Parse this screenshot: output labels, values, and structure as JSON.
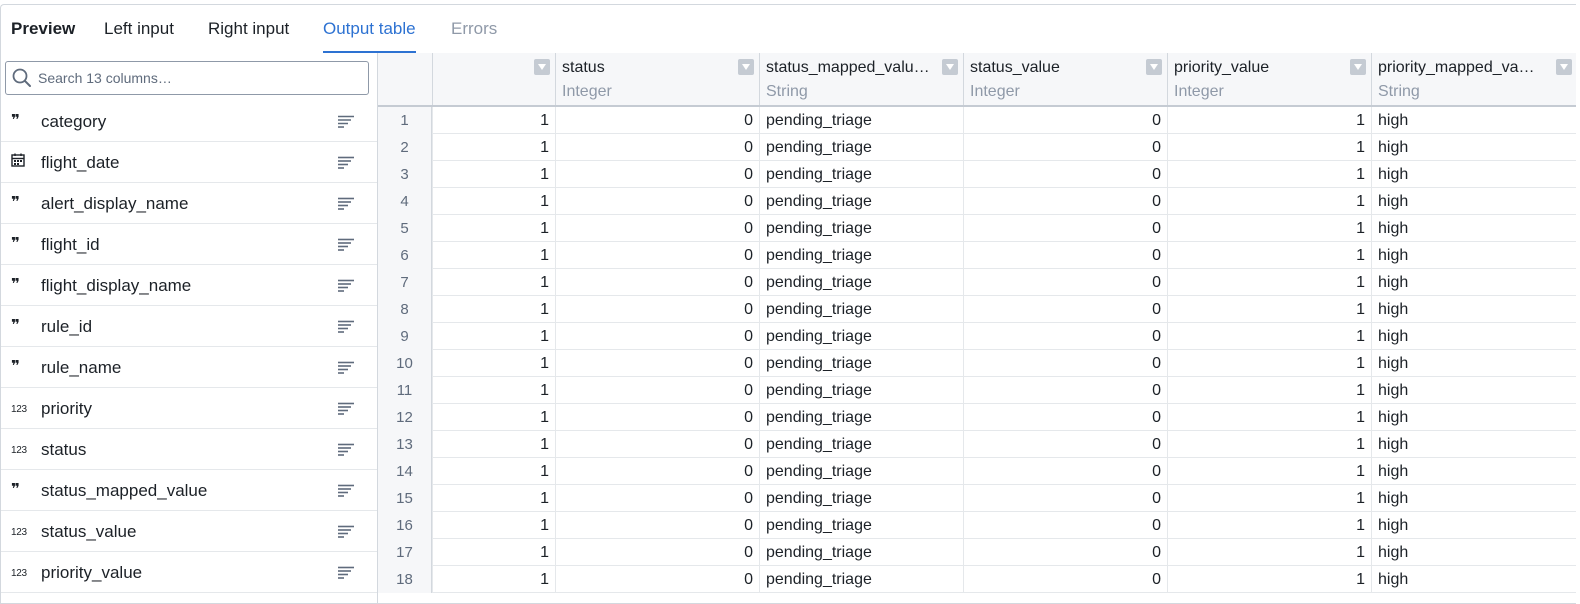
{
  "tabs": [
    {
      "label": "Preview",
      "state": "bold"
    },
    {
      "label": "Left input",
      "state": "normal"
    },
    {
      "label": "Right input",
      "state": "normal"
    },
    {
      "label": "Output table",
      "state": "active"
    },
    {
      "label": "Errors",
      "state": "disabled"
    }
  ],
  "sidebar": {
    "search_placeholder": "Search 13 columns…",
    "columns": [
      {
        "name": "category",
        "type_icon": "quote-icon"
      },
      {
        "name": "flight_date",
        "type_icon": "calendar-icon"
      },
      {
        "name": "alert_display_name",
        "type_icon": "quote-icon"
      },
      {
        "name": "flight_id",
        "type_icon": "quote-icon"
      },
      {
        "name": "flight_display_name",
        "type_icon": "quote-icon"
      },
      {
        "name": "rule_id",
        "type_icon": "quote-icon"
      },
      {
        "name": "rule_name",
        "type_icon": "quote-icon"
      },
      {
        "name": "priority",
        "type_icon": "numeric-icon"
      },
      {
        "name": "status",
        "type_icon": "numeric-icon"
      },
      {
        "name": "status_mapped_value",
        "type_icon": "quote-icon"
      },
      {
        "name": "status_value",
        "type_icon": "numeric-icon"
      },
      {
        "name": "priority_value",
        "type_icon": "numeric-icon"
      }
    ]
  },
  "icons": {
    "quote": "❞",
    "numeric": "123"
  },
  "table": {
    "columns": [
      {
        "name": "",
        "type": ""
      },
      {
        "name": "status",
        "type": "Integer"
      },
      {
        "name": "status_mapped_valu…",
        "type": "String"
      },
      {
        "name": "status_value",
        "type": "Integer"
      },
      {
        "name": "priority_value",
        "type": "Integer"
      },
      {
        "name": "priority_mapped_va…",
        "type": "String"
      }
    ],
    "rows": [
      [
        "1",
        "1",
        "0",
        "pending_triage",
        "0",
        "1",
        "high"
      ],
      [
        "2",
        "1",
        "0",
        "pending_triage",
        "0",
        "1",
        "high"
      ],
      [
        "3",
        "1",
        "0",
        "pending_triage",
        "0",
        "1",
        "high"
      ],
      [
        "4",
        "1",
        "0",
        "pending_triage",
        "0",
        "1",
        "high"
      ],
      [
        "5",
        "1",
        "0",
        "pending_triage",
        "0",
        "1",
        "high"
      ],
      [
        "6",
        "1",
        "0",
        "pending_triage",
        "0",
        "1",
        "high"
      ],
      [
        "7",
        "1",
        "0",
        "pending_triage",
        "0",
        "1",
        "high"
      ],
      [
        "8",
        "1",
        "0",
        "pending_triage",
        "0",
        "1",
        "high"
      ],
      [
        "9",
        "1",
        "0",
        "pending_triage",
        "0",
        "1",
        "high"
      ],
      [
        "10",
        "1",
        "0",
        "pending_triage",
        "0",
        "1",
        "high"
      ],
      [
        "11",
        "1",
        "0",
        "pending_triage",
        "0",
        "1",
        "high"
      ],
      [
        "12",
        "1",
        "0",
        "pending_triage",
        "0",
        "1",
        "high"
      ],
      [
        "13",
        "1",
        "0",
        "pending_triage",
        "0",
        "1",
        "high"
      ],
      [
        "14",
        "1",
        "0",
        "pending_triage",
        "0",
        "1",
        "high"
      ],
      [
        "15",
        "1",
        "0",
        "pending_triage",
        "0",
        "1",
        "high"
      ],
      [
        "16",
        "1",
        "0",
        "pending_triage",
        "0",
        "1",
        "high"
      ],
      [
        "17",
        "1",
        "0",
        "pending_triage",
        "0",
        "1",
        "high"
      ],
      [
        "18",
        "1",
        "0",
        "pending_triage",
        "0",
        "1",
        "high"
      ]
    ]
  },
  "colors": {
    "accent": "#2d72d2",
    "muted_text": "#8f99a8",
    "header_bg": "#f6f7f9",
    "border": "#d3d8de"
  }
}
